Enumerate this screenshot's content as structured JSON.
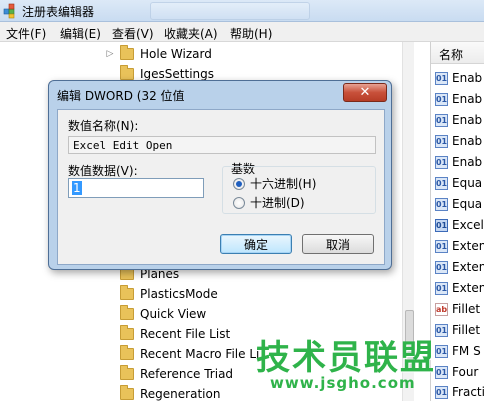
{
  "window": {
    "title": "注册表编辑器"
  },
  "menu": [
    "文件(F)",
    "编辑(E)",
    "查看(V)",
    "收藏夹(A)",
    "帮助(H)"
  ],
  "tree": {
    "top_items": [
      "Hole Wizard",
      "IgesSettings"
    ],
    "bottom_items": [
      "Planes",
      "PlasticsMode",
      "Quick View",
      "Recent File List",
      "Recent Macro File Li",
      "Reference Triad",
      "Regeneration"
    ]
  },
  "values_pane": {
    "header": "名称",
    "rows": [
      {
        "label": "Enab",
        "type": "bin"
      },
      {
        "label": "Enab",
        "type": "bin"
      },
      {
        "label": "Enab",
        "type": "bin"
      },
      {
        "label": "Enab",
        "type": "bin"
      },
      {
        "label": "Enab",
        "type": "bin"
      },
      {
        "label": "Equa",
        "type": "bin"
      },
      {
        "label": "Equa",
        "type": "bin"
      },
      {
        "label": "Excel",
        "type": "sel"
      },
      {
        "label": "Exten",
        "type": "bin"
      },
      {
        "label": "Exten",
        "type": "bin"
      },
      {
        "label": "Exten",
        "type": "bin"
      },
      {
        "label": "Fillet",
        "type": "sz"
      },
      {
        "label": "Fillet",
        "type": "bin"
      },
      {
        "label": "FM S",
        "type": "bin"
      },
      {
        "label": "Four",
        "type": "bin"
      },
      {
        "label": "Fracti",
        "type": "bin"
      }
    ]
  },
  "dialog": {
    "title": "编辑 DWORD (32 位值",
    "close_symbol": "✕",
    "name_label": "数值名称(N):",
    "name_value": "Excel Edit Open",
    "data_label": "数值数据(V):",
    "data_value": "1",
    "base_label": "基数",
    "radio_hex": "十六进制(H)",
    "radio_dec": "十进制(D)",
    "selected_base": "hex",
    "ok_label": "确定",
    "cancel_label": "取消"
  },
  "watermark": {
    "main": "技术员联盟",
    "url": "www.jsgho.com"
  }
}
